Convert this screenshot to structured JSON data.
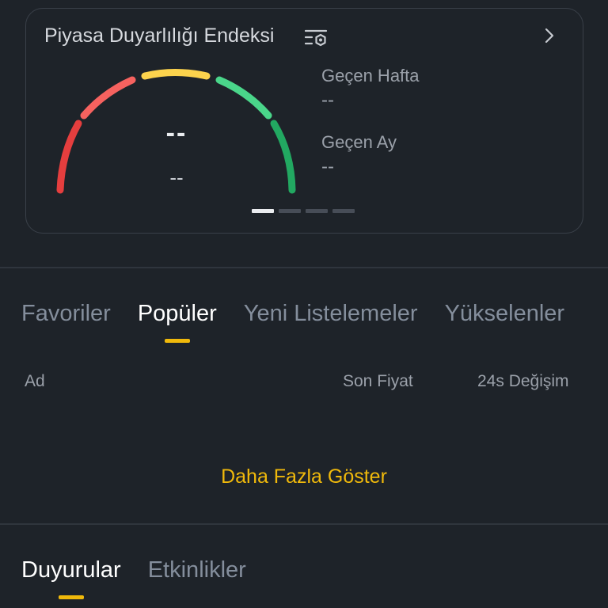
{
  "sentiment_card": {
    "title": "Piyasa Duyarlılığı Endeksi",
    "value": "--",
    "sub_value": "--",
    "stats": [
      {
        "label": "Geçen Hafta",
        "value": "--"
      },
      {
        "label": "Geçen Ay",
        "value": "--"
      }
    ],
    "pager": {
      "pages": 4,
      "active_index": 0
    },
    "gauge_colors": [
      "#e53e3e",
      "#f6625f",
      "#fcd34d",
      "#4ad68a",
      "#22a861"
    ],
    "icons": [
      "filter-settings-icon",
      "chevron-right-icon"
    ]
  },
  "market_tabs": [
    {
      "label": "Favoriler",
      "active": false
    },
    {
      "label": "Popüler",
      "active": true
    },
    {
      "label": "Yeni Listelemeler",
      "active": false
    },
    {
      "label": "Yükselenler",
      "active": false
    }
  ],
  "table_header": {
    "name": "Ad",
    "last_price": "Son Fiyat",
    "change_24h": "24s Değişim"
  },
  "show_more": "Daha Fazla Göster",
  "news_tabs": [
    {
      "label": "Duyurular",
      "active": true
    },
    {
      "label": "Etkinlikler",
      "active": false
    }
  ],
  "colors": {
    "background": "#1e2329",
    "accent": "#f0b90b",
    "muted_text": "#848e9c"
  }
}
